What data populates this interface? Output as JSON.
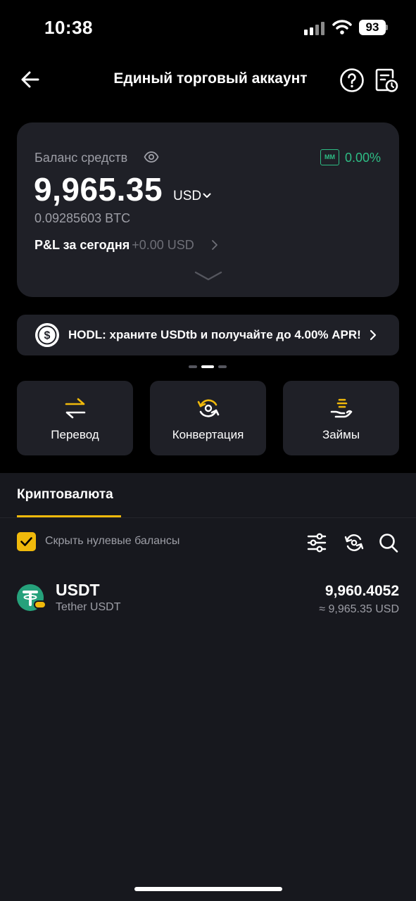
{
  "status_bar": {
    "time": "10:38",
    "battery": "93"
  },
  "header": {
    "title": "Единый торговый аккаунт"
  },
  "balance": {
    "label": "Баланс средств",
    "mm_badge": "MM",
    "mm_value": "0.00%",
    "amount": "9,965.35",
    "currency": "USD",
    "btc": "0.09285603 BTC",
    "pnl_label": "P&L за сегодня",
    "pnl_value": "+0.00 USD"
  },
  "promo": {
    "text": "HODL: храните USDtb и получайте до 4.00% APR!"
  },
  "actions": [
    {
      "label": "Перевод",
      "icon": "transfer-icon"
    },
    {
      "label": "Конвертация",
      "icon": "convert-icon"
    },
    {
      "label": "Займы",
      "icon": "loans-icon"
    }
  ],
  "tabs": {
    "crypto": "Криптовалюта"
  },
  "filters": {
    "hide_zero": "Скрыть нулевые балансы",
    "hide_zero_checked": true
  },
  "assets": [
    {
      "symbol": "USDT",
      "name": "Tether USDT",
      "amount": "9,960.4052",
      "usd": "≈ 9,965.35 USD"
    }
  ],
  "colors": {
    "accent": "#f0b90b",
    "positive": "#2ebd85",
    "background": "#17181e",
    "card": "#1f2027"
  }
}
